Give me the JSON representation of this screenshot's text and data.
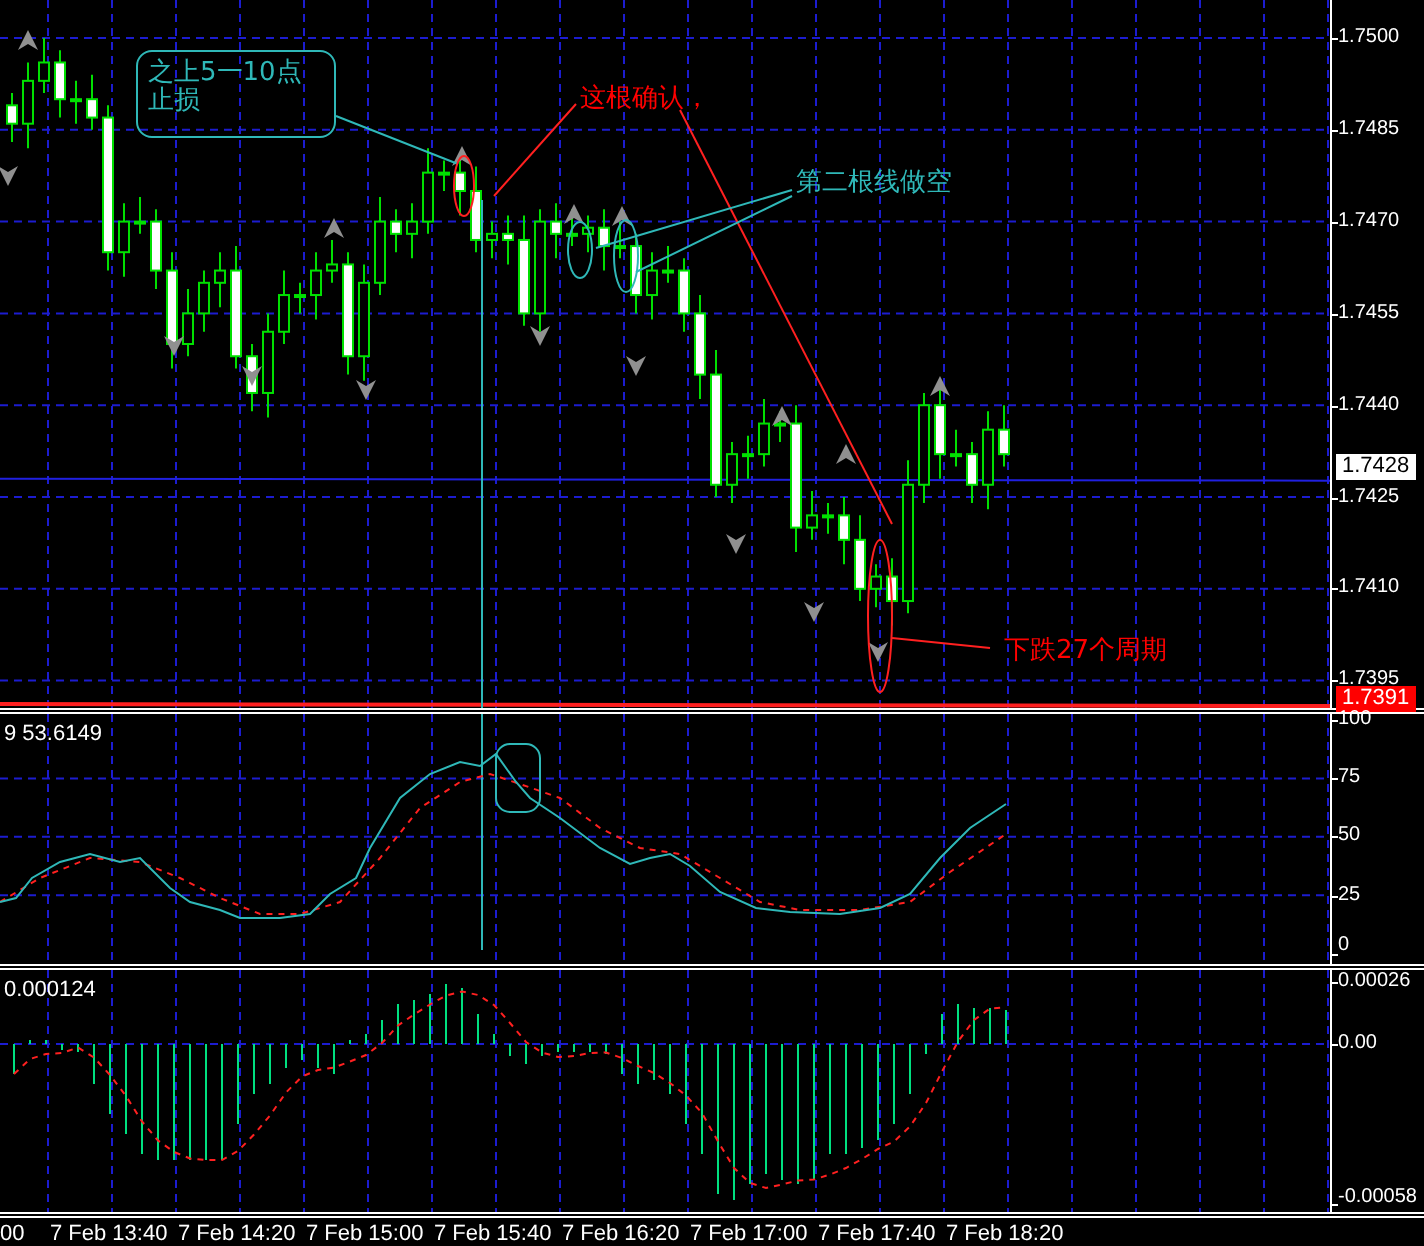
{
  "price_panel": {
    "axis_labels": [
      {
        "value": "1.7500"
      },
      {
        "value": "1.7485"
      },
      {
        "value": "1.7470"
      },
      {
        "value": "1.7455"
      },
      {
        "value": "1.7440"
      },
      {
        "value": "1.7425"
      },
      {
        "value": "1.7410"
      },
      {
        "value": "1.7395"
      }
    ],
    "current_price": "1.7428",
    "alert_price": "1.7391",
    "annotations": [
      {
        "kind": "box",
        "text": "之上5一10点止损",
        "color": "#2fb8b8"
      },
      {
        "kind": "label",
        "text": "这根确认，",
        "color": "#ff0000"
      },
      {
        "kind": "label",
        "text": "第二根线做空",
        "color": "#2fb8b8"
      },
      {
        "kind": "label",
        "text": "下跌27个周期",
        "color": "#ff0000"
      }
    ]
  },
  "stochastic_panel": {
    "label": "9 53.6149",
    "axis_labels": [
      "100",
      "75",
      "50",
      "25",
      "0"
    ]
  },
  "macd_panel": {
    "label": "0.000124",
    "axis_labels": [
      "0.00026",
      "0.00",
      "-0.00058"
    ]
  },
  "time_axis": [
    "00",
    "7 Feb 13:40",
    "7 Feb 14:20",
    "7 Feb 15:00",
    "7 Feb 15:40",
    "7 Feb 16:20",
    "7 Feb 17:00",
    "7 Feb 17:40",
    "7 Feb 18:20"
  ]
}
